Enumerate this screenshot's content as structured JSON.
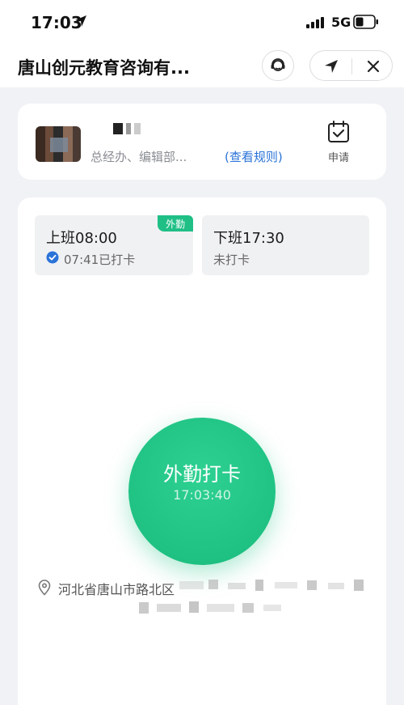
{
  "status_bar": {
    "time": "17:03",
    "network": "5G"
  },
  "title_bar": {
    "title": "唐山创元教育咨询有...",
    "support_icon": "headset-icon",
    "location_icon": "navigation-arrow-icon",
    "close_icon": "close-icon"
  },
  "user": {
    "department": "总经办、编辑部...",
    "rules_link": "(查看规则)",
    "apply_label": "申请",
    "apply_icon": "calendar-check-icon"
  },
  "shifts": [
    {
      "title": "上班08:00",
      "status": "07:41已打卡",
      "badge": "外勤",
      "checked": true
    },
    {
      "title": "下班17:30",
      "status": "未打卡"
    }
  ],
  "punch": {
    "label": "外勤打卡",
    "time": "17:03:40"
  },
  "location": {
    "address": "河北省唐山市路北区"
  },
  "colors": {
    "accent_green": "#1fc283",
    "link_blue": "#2a73d8",
    "background": "#f1f2f5"
  }
}
